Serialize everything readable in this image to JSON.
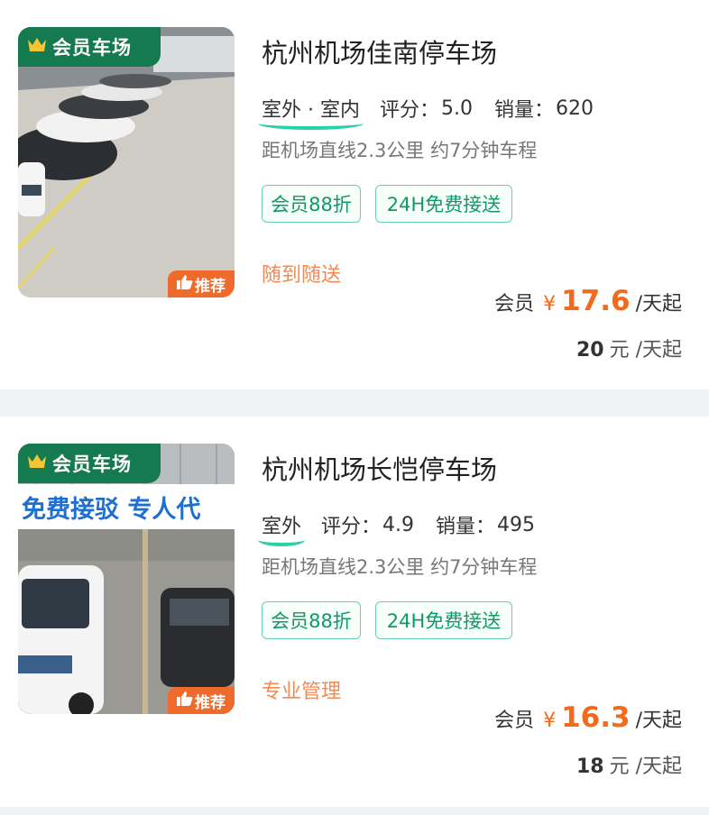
{
  "listings": [
    {
      "member_tag": "会员车场",
      "recommend_tag": "推荐",
      "title": "杭州机场佳南停车场",
      "environment": "室外 · 室内",
      "rating_label": "评分：",
      "rating": "5.0",
      "sales_label": "销量：",
      "sales": "620",
      "distance": "距机场直线2.3公里 约7分钟车程",
      "tags": [
        "会员88折",
        "24H免费接送"
      ],
      "feature": "随到随送",
      "member_price_label": "会员",
      "currency": "¥",
      "member_price": "17.6",
      "price_unit": "/天起",
      "normal_price": "20",
      "normal_unit": "元 /天起"
    },
    {
      "member_tag": "会员车场",
      "recommend_tag": "推荐",
      "banner_text": "免费接驳  专人代",
      "title": "杭州机场长恺停车场",
      "environment": "室外",
      "rating_label": "评分：",
      "rating": "4.9",
      "sales_label": "销量：",
      "sales": "495",
      "distance": "距机场直线2.3公里 约7分钟车程",
      "tags": [
        "会员88折",
        "24H免费接送"
      ],
      "feature": "专业管理",
      "member_price_label": "会员",
      "currency": "¥",
      "member_price": "16.3",
      "price_unit": "/天起",
      "normal_price": "18",
      "normal_unit": "元 /天起"
    }
  ],
  "colors": {
    "member_tag_bg": "#157a4f",
    "recommend_bg": "#f06a2b",
    "price_orange": "#f26b1d",
    "tag_green": "#11986a",
    "feature_orange": "#f08a55"
  }
}
